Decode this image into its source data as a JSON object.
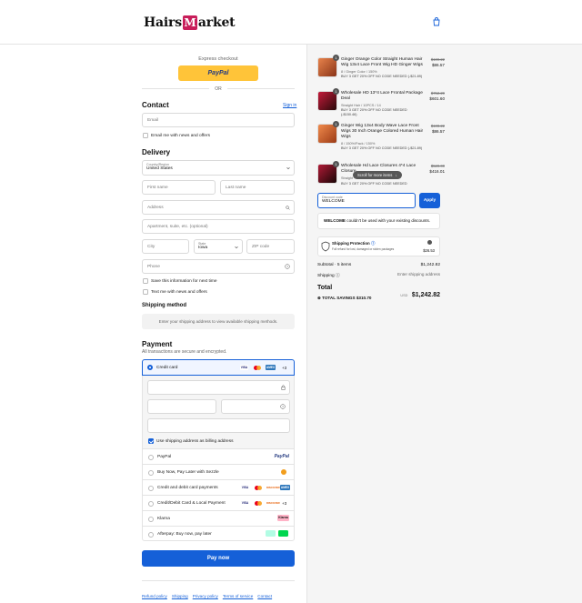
{
  "header": {
    "logo_text_left": "Hairs",
    "logo_text_m": "M",
    "logo_text_right": "arket"
  },
  "express": {
    "label": "Express checkout",
    "paypal": "PayPal",
    "or": "OR"
  },
  "contact": {
    "title": "Contact",
    "sign_in": "Sign in",
    "email_placeholder": "Email",
    "email_news": "Email me with news and offers"
  },
  "delivery": {
    "title": "Delivery",
    "country_label": "Country/Region",
    "country_value": "United States",
    "first_name": "First name",
    "last_name": "Last name",
    "address": "Address",
    "apartment": "Apartment, suite, etc. (optional)",
    "city": "City",
    "state_label": "State",
    "state_value": "Iowa",
    "zip": "ZIP code",
    "phone": "Phone",
    "save_info": "Save this information for next time",
    "text_news": "Text me with news and offers"
  },
  "shipping_method": {
    "title": "Shipping method",
    "note": "Enter your shipping address to view available shipping methods."
  },
  "payment": {
    "title": "Payment",
    "subtitle": "All transactions are secure and encrypted.",
    "credit_card": "Credit card",
    "card_more": "+3",
    "billing_same": "Use shipping address as billing address",
    "options": [
      {
        "label": "PayPal"
      },
      {
        "label": "Buy Now, Pay Later with Sezzle"
      },
      {
        "label": "Credit and debit card payments"
      },
      {
        "label": "Credit/Debit Card & Local Payment"
      },
      {
        "label": "Klarna"
      },
      {
        "label": "Afterpay: Buy now, pay later"
      }
    ],
    "paypal_logo": "PayPal",
    "klarna_logo": "Klarna",
    "more_3": "+3",
    "pay_now": "Pay now"
  },
  "footer_links": [
    "Refund policy",
    "Shipping",
    "Privacy policy",
    "Terms of service",
    "Contact"
  ],
  "cart": {
    "items": [
      {
        "qty": "1",
        "title": "Ginger Orange Color Straight Human Hair Wig 13x4 Lace Front Wig HD Ginger Wigs",
        "variant": "8 / Ginger Color / 150%",
        "discount": "BUY 3 GET 20% OFF NO CODE NEEDED (-$21.89)",
        "old": "$109.22",
        "new": "$86.57"
      },
      {
        "qty": "1",
        "title": "Wholesale HD 13*4 Lace Frontal Package Deal",
        "variant": "Straight Hair / 10PCS / 14",
        "discount": "BUY 3 GET 20% OFF NO CODE NEEDED (-$150.46)",
        "old": "$752.29",
        "new": "$601.60"
      },
      {
        "qty": "1",
        "title": "Ginger Wig 13x4 Body Wave Lace Front Wigs 30 Inch Orange Colored Human Hair Wigs",
        "variant": "8 / 150%/Pack / 150%",
        "discount": "BUY 3 GET 20% OFF NO CODE NEEDED (-$21.89)",
        "old": "$108.22",
        "new": "$86.57"
      },
      {
        "qty": "1",
        "title": "Wholesale Hd Lace Closures 4*4 Lace Closure",
        "variant": "Straight",
        "discount": "BUY 3 GET 20% OFF NO CODE NEEDED",
        "old": "$520.00",
        "new": "$416.01"
      }
    ],
    "scroll_tip": "Scroll for more items",
    "discount_label": "Discount code",
    "discount_value": "WELCOME",
    "apply": "Apply",
    "welcome_msg_bold": "WELCOME",
    "welcome_msg_rest": " couldn't be used with your existing discounts.",
    "protection_title": "Shipping Protection",
    "protection_desc": "Full refund for lost, damaged or stolen packages",
    "protection_price": "$26.53",
    "subtotal_label": "Subtotal · 5 items",
    "subtotal_value": "$1,242.82",
    "shipping_label": "Shipping",
    "shipping_value": "Enter shipping address",
    "total_label": "Total",
    "total_currency": "USD",
    "total_value": "$1,242.82",
    "savings": "TOTAL SAVINGS $310.70"
  },
  "colors": {
    "accent": "#1560d8",
    "paypal_yellow": "#ffc439",
    "brand": "#c81e5a"
  }
}
